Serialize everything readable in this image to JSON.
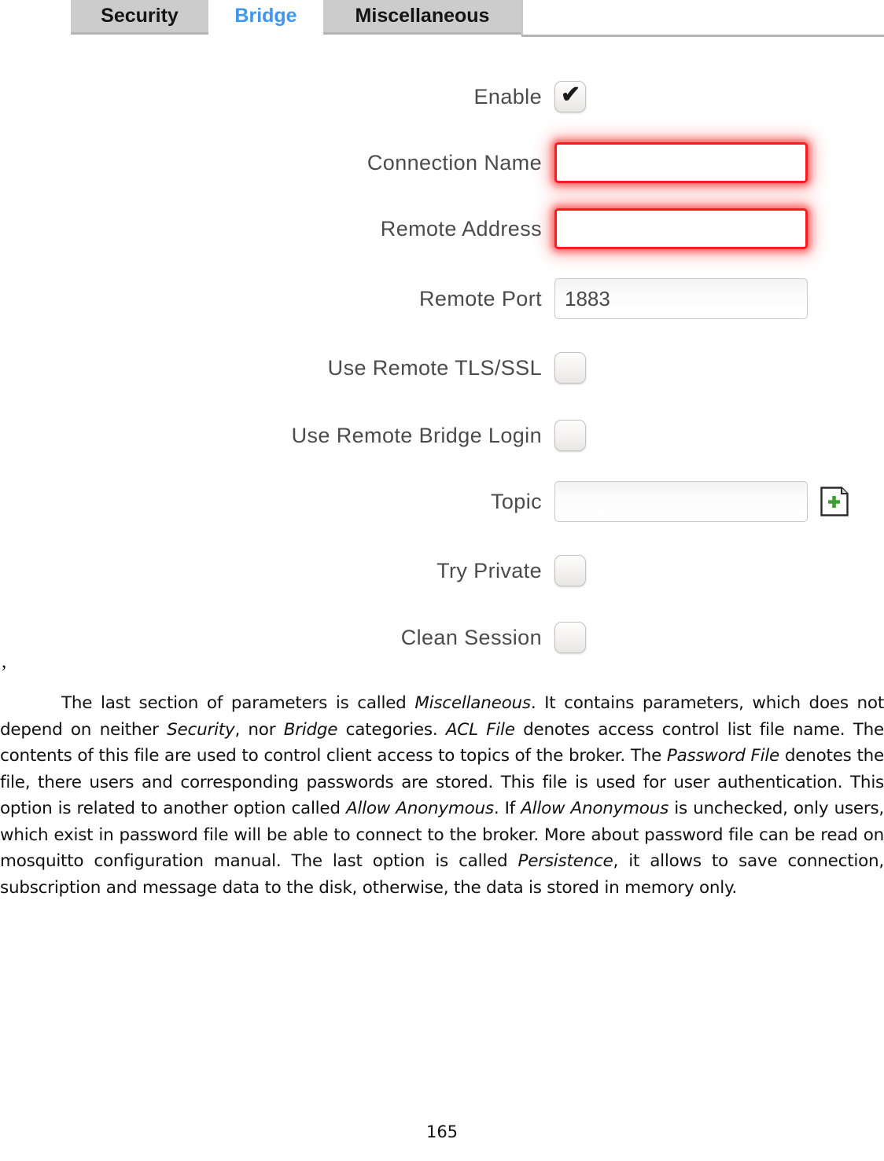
{
  "tabs": [
    {
      "label": "Security",
      "active": false
    },
    {
      "label": "Bridge",
      "active": true
    },
    {
      "label": "Miscellaneous",
      "active": false
    }
  ],
  "form": {
    "rows": [
      {
        "label": "Enable",
        "type": "checkbox",
        "checked": true
      },
      {
        "label": "Connection Name",
        "type": "text",
        "value": "",
        "placeholder": "",
        "invalid": true
      },
      {
        "label": "Remote Address",
        "type": "text",
        "value": "",
        "placeholder": "",
        "invalid": true
      },
      {
        "label": "Remote Port",
        "type": "text",
        "value": "1883",
        "placeholder": "",
        "invalid": false
      },
      {
        "label": "Use Remote TLS/SSL",
        "type": "checkbox",
        "checked": false
      },
      {
        "label": "Use Remote Bridge Login",
        "type": "checkbox",
        "checked": false
      },
      {
        "label": "Topic",
        "type": "text-add",
        "value": "",
        "placeholder": "",
        "invalid": false,
        "add_icon": "add-document-icon"
      },
      {
        "label": "Try Private",
        "type": "checkbox",
        "checked": false
      },
      {
        "label": "Clean Session",
        "type": "checkbox",
        "checked": false
      }
    ]
  },
  "colors": {
    "tab_active_text": "#3d96f0",
    "tab_background": "#cccccc",
    "invalid_border": "#fb1c1c",
    "add_icon_plus": "#3d9e33",
    "label_text": "#4b4b4b"
  },
  "document": {
    "stray_mark": ",",
    "paragraph_parts": [
      {
        "text": "The last section of parameters is called ",
        "italic": false
      },
      {
        "text": "Miscellaneous",
        "italic": true
      },
      {
        "text": ". It contains parameters, which does not depend on neither ",
        "italic": false
      },
      {
        "text": "Security",
        "italic": true
      },
      {
        "text": ", nor ",
        "italic": false
      },
      {
        "text": "Bridge",
        "italic": true
      },
      {
        "text": " categories. ",
        "italic": false
      },
      {
        "text": "ACL File",
        "italic": true
      },
      {
        "text": " denotes access control list file name. The contents of this file are used to control client access to topics of the broker. The ",
        "italic": false
      },
      {
        "text": "Password File",
        "italic": true
      },
      {
        "text": " denotes the file, there users and corresponding passwords are stored. This file is used for user authentication. This option is related to another option called ",
        "italic": false
      },
      {
        "text": "Allow Anonymous",
        "italic": true
      },
      {
        "text": ". If ",
        "italic": false
      },
      {
        "text": "Allow Anonymous",
        "italic": true
      },
      {
        "text": " is unchecked, only users, which exist in password file will be able to connect to the broker. More about password file can be read on mosquitto configuration manual. The last option is called ",
        "italic": false
      },
      {
        "text": "Persistence",
        "italic": true
      },
      {
        "text": ", it allows to save connection, subscription and message data to the disk, otherwise, the data is stored in memory only.",
        "italic": false
      }
    ],
    "page_number": "165"
  }
}
